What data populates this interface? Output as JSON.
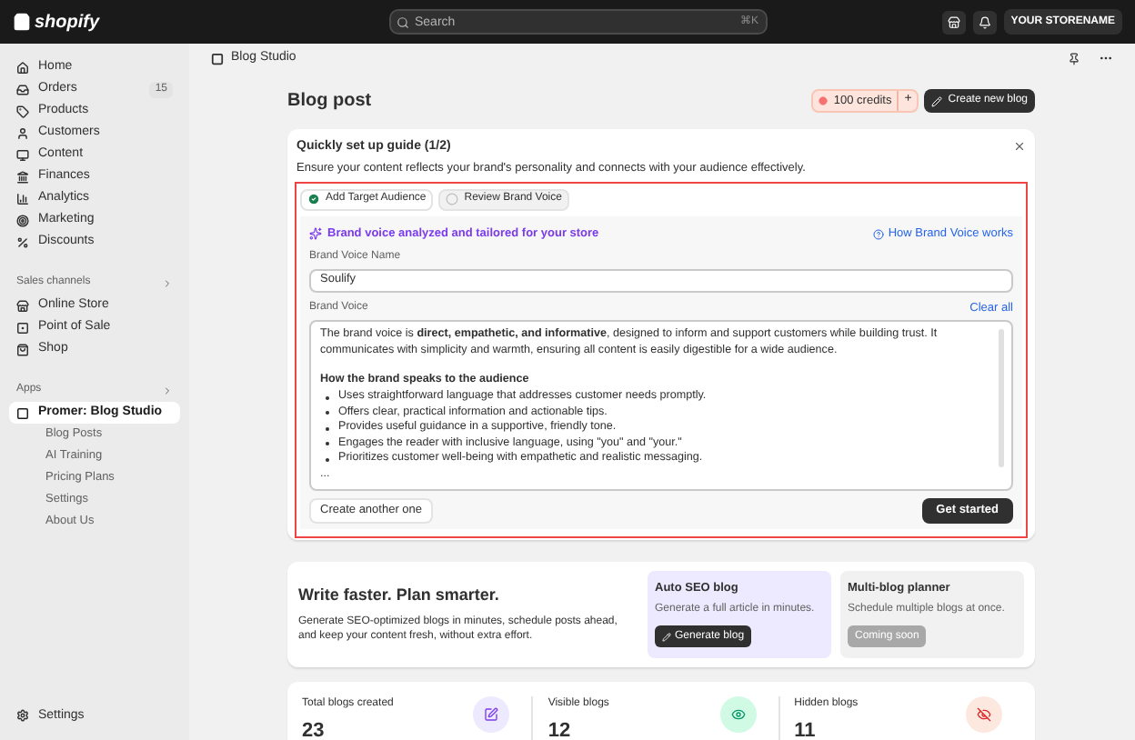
{
  "topbar": {
    "logo": "shopify",
    "search": {
      "placeholder": "Search",
      "shortcut": "⌘K"
    },
    "store": "YOUR STORENAME"
  },
  "sidebar": {
    "items": [
      {
        "label": "Home",
        "selected": false
      },
      {
        "label": "Orders",
        "badge": "15",
        "selected": false
      },
      {
        "label": "Products",
        "selected": false
      },
      {
        "label": "Customers",
        "selected": false
      },
      {
        "label": "Content",
        "selected": false
      },
      {
        "label": "Finances",
        "selected": false
      },
      {
        "label": "Analytics",
        "selected": false
      },
      {
        "label": "Marketing",
        "selected": false
      },
      {
        "label": "Discounts",
        "selected": false
      }
    ],
    "sales_channels": {
      "title": "Sales channels",
      "items": [
        {
          "label": "Online Store",
          "selected": false
        },
        {
          "label": "Point of Sale",
          "selected": false
        },
        {
          "label": "Shop",
          "selected": false
        }
      ]
    },
    "apps": {
      "title": "Apps",
      "items": [
        {
          "label": "Promer: Blog Studio",
          "selected": true,
          "children": [
            {
              "label": "Blog Posts"
            },
            {
              "label": "AI Training"
            },
            {
              "label": "Pricing Plans"
            },
            {
              "label": "Settings"
            },
            {
              "label": "About Us"
            }
          ]
        }
      ]
    },
    "footer": {
      "label": "Settings"
    }
  },
  "app_header": {
    "title": "Blog Studio"
  },
  "page": {
    "title": "Blog post",
    "credits": "100 credits",
    "add": "+",
    "create_button": "Create new blog"
  },
  "setup_guide": {
    "title": "Quickly set up guide (1/2)",
    "description": "Ensure your content reflects your brand's personality and connects with your audience effectively.",
    "steps": [
      {
        "label": "Add Target Audience",
        "checked": true,
        "selected": false
      },
      {
        "label": "Review Brand Voice",
        "checked": false,
        "selected": true
      }
    ],
    "banner": "Brand voice analyzed and tailored for your store",
    "help_link": "How Brand Voice works",
    "name_label": "Brand Voice Name",
    "name_value": "Soulify",
    "voice_label": "Brand Voice",
    "clear": "Clear all",
    "voice_intro": "The brand voice is **direct, empathetic, and informative**, designed to inform and support customers while building trust. It communicates with simplicity and warmth, ensuring all content is easily digestible for a wide audience.",
    "voice_heading": "How the brand speaks to the audience",
    "voice_bullets": [
      "Uses straightforward language that addresses customer needs promptly.",
      "Offers clear, practical information and actionable tips.",
      "Provides useful guidance in a supportive, friendly tone.",
      "Engages the reader with inclusive language, using \"you\" and \"your.\"",
      "Prioritizes customer well-being with empathetic and realistic messaging."
    ],
    "voice_more": "...",
    "secondary_button": "Create another one",
    "primary_button": "Get started"
  },
  "promo": {
    "title": "Write faster. Plan smarter.",
    "text": "Generate SEO-optimized blogs in minutes, schedule posts ahead, and keep your content fresh, without extra effort.",
    "cards": [
      {
        "title": "Auto SEO blog",
        "text": "Generate a full article in minutes.",
        "button": "Generate blog",
        "disabled": false
      },
      {
        "title": "Multi-blog planner",
        "text": "Schedule multiple blogs at once.",
        "button": "Coming soon",
        "disabled": true
      }
    ]
  },
  "stats": [
    {
      "label": "Total blogs created",
      "value": "23",
      "color": "#ede9fe"
    },
    {
      "label": "Visible blogs",
      "value": "12",
      "color": "#d1fae5"
    },
    {
      "label": "Hidden blogs",
      "value": "11",
      "color": "#fde8e0"
    }
  ]
}
